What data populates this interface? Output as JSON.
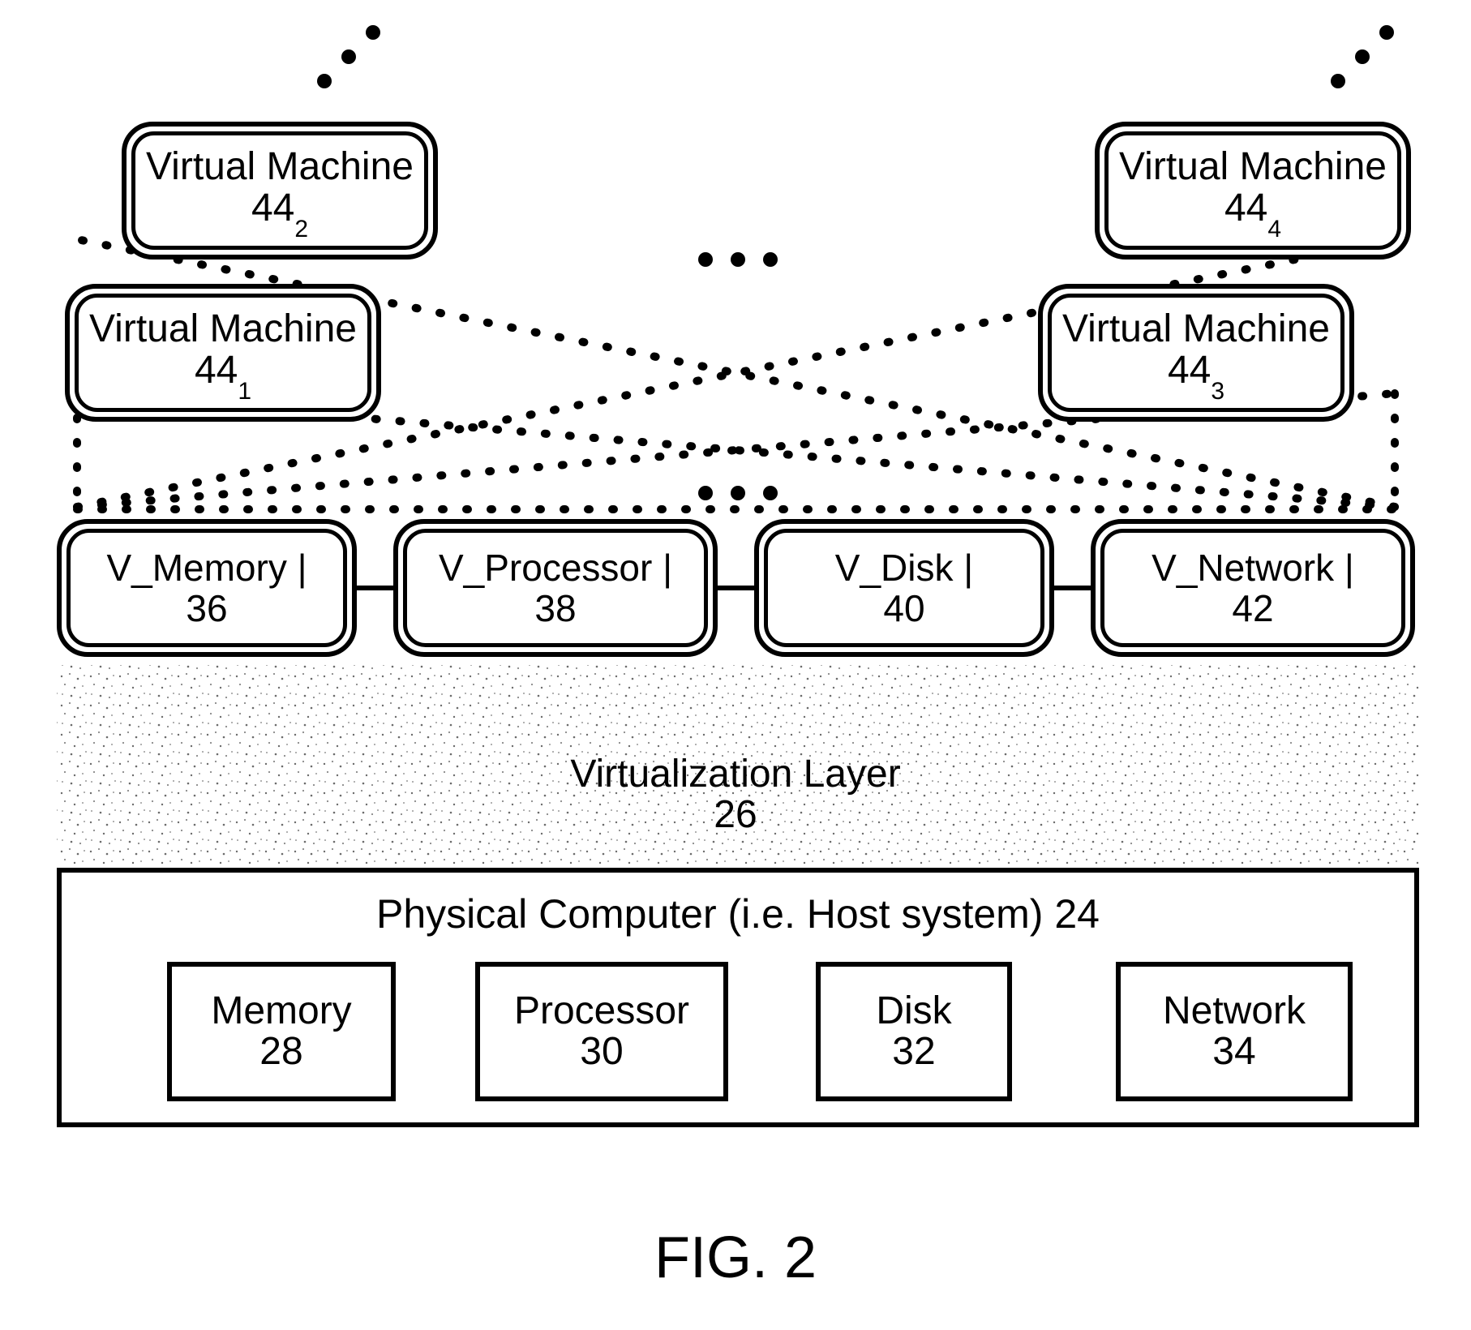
{
  "figure_caption": "FIG. 2",
  "virtual_machines": {
    "label": "Virtual Machine",
    "ref_base": "44",
    "instances": [
      "1",
      "2",
      "3",
      "4"
    ]
  },
  "virtual_resources": [
    {
      "name": "V_Memory |",
      "ref": "36"
    },
    {
      "name": "V_Processor |",
      "ref": "38"
    },
    {
      "name": "V_Disk |",
      "ref": "40"
    },
    {
      "name": "V_Network |",
      "ref": "42"
    }
  ],
  "virtualization_layer": {
    "label": "Virtualization Layer",
    "ref": "26"
  },
  "physical_computer": {
    "title": "Physical Computer (i.e. Host system)  24",
    "components": [
      {
        "name": "Memory",
        "ref": "28"
      },
      {
        "name": "Processor",
        "ref": "30"
      },
      {
        "name": "Disk",
        "ref": "32"
      },
      {
        "name": "Network",
        "ref": "34"
      }
    ]
  }
}
